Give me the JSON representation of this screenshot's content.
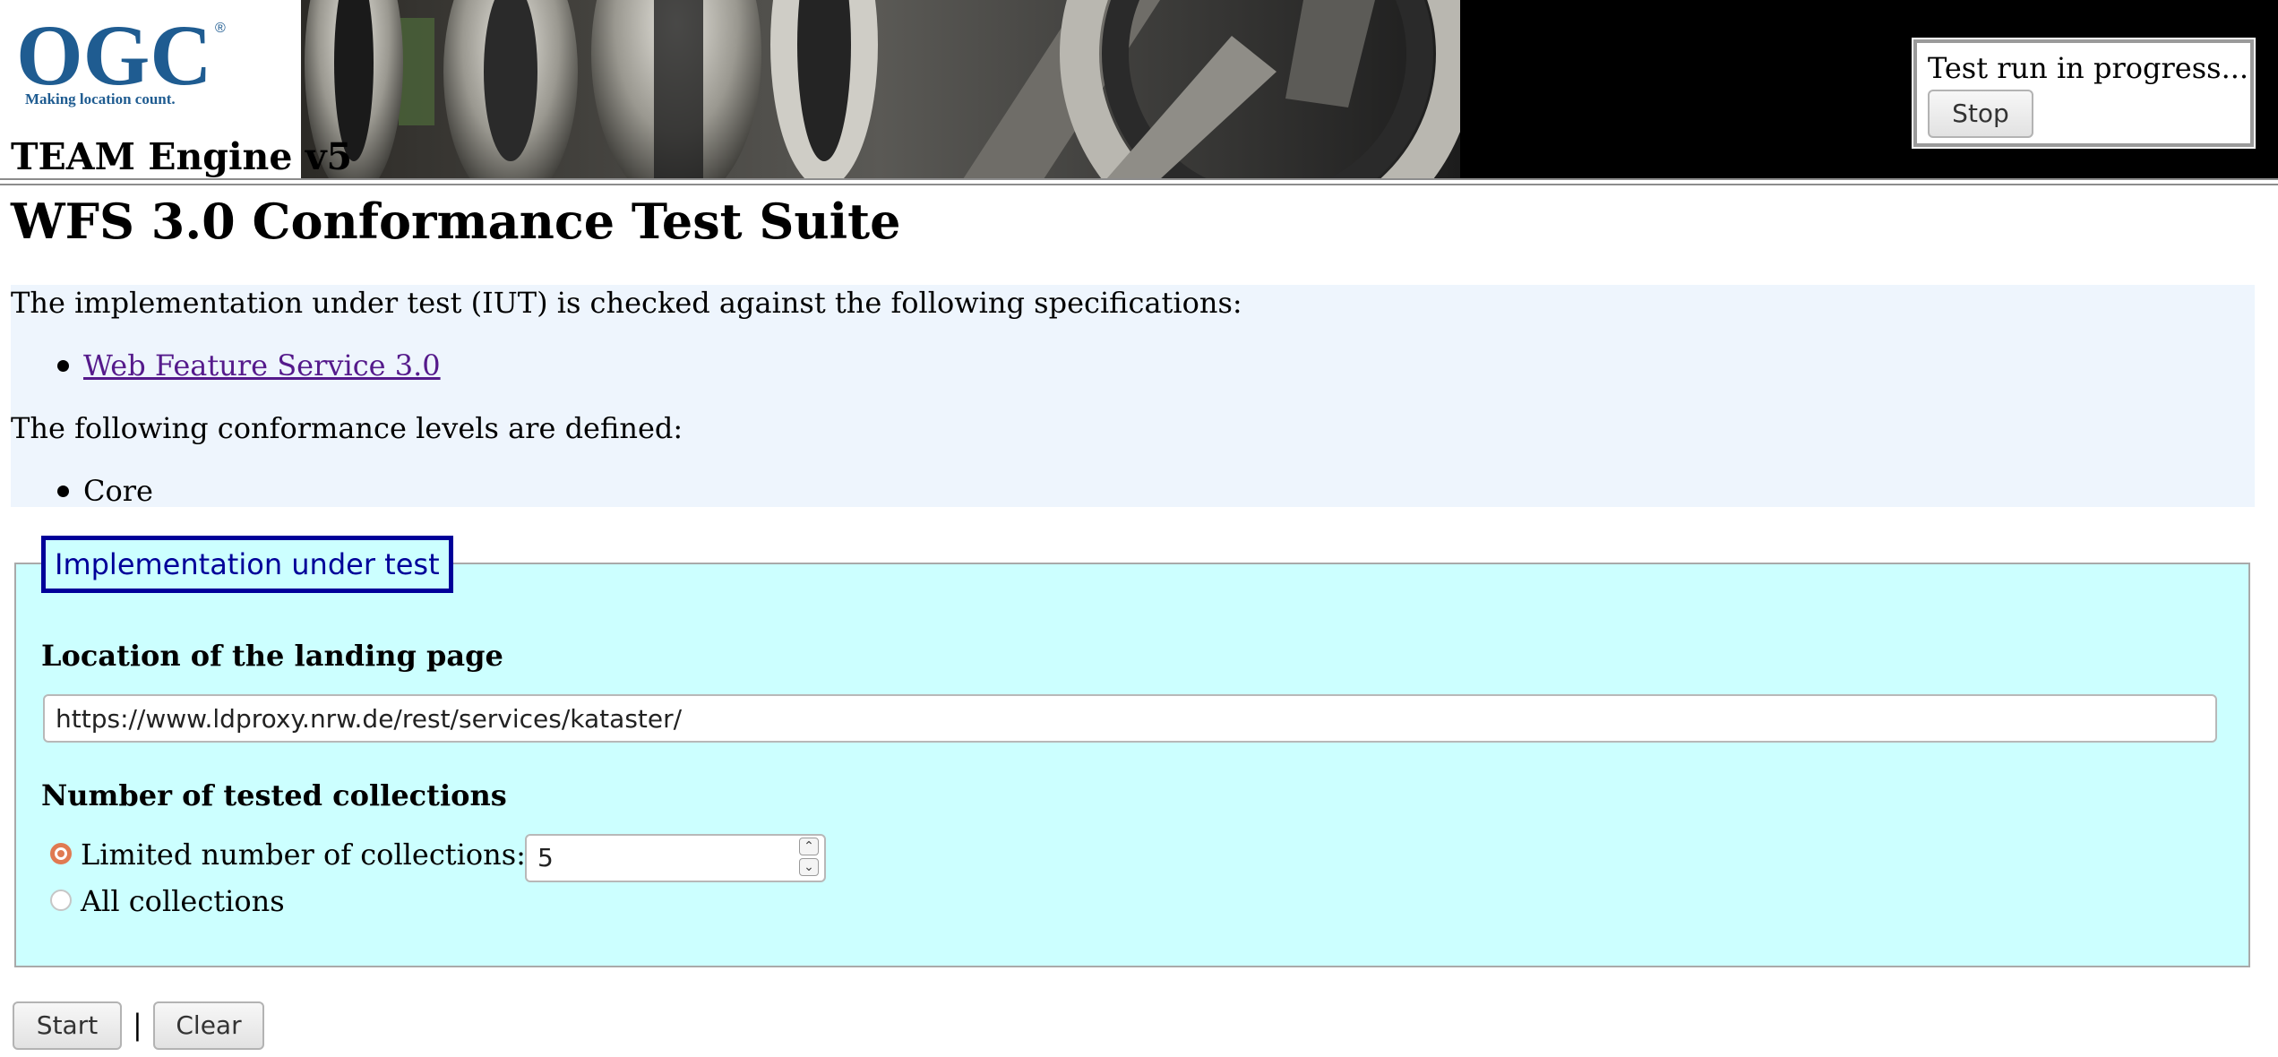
{
  "header": {
    "logo_text": "OGC",
    "logo_tagline": "Making location count.",
    "app_title": "TEAM Engine v5",
    "progress_text": "Test run in progress...",
    "stop_label": "Stop"
  },
  "page": {
    "title": "WFS 3.0 Conformance Test Suite",
    "spec_intro": "The implementation under test (IUT) is checked against the following specifications:",
    "spec_links": [
      "Web Feature Service 3.0"
    ],
    "conformance_intro": "The following conformance levels are defined:",
    "conformance_levels": [
      "Core"
    ]
  },
  "form": {
    "legend": "Implementation under test",
    "landing_label": "Location of the landing page",
    "landing_value": "https://www.ldproxy.nrw.de/rest/services/kataster/",
    "collections_label": "Number of tested collections",
    "limited_label": "Limited number of collections:",
    "limited_count": "5",
    "all_label": "All collections",
    "selected_option": "limited"
  },
  "actions": {
    "start_label": "Start",
    "separator": "|",
    "clear_label": "Clear"
  },
  "colors": {
    "legend_border": "#000099",
    "fieldset_bg": "#ccffff",
    "spec_panel_bg": "#eef5fd",
    "visited_link": "#551a8b",
    "logo_blue": "#1f5c91"
  }
}
